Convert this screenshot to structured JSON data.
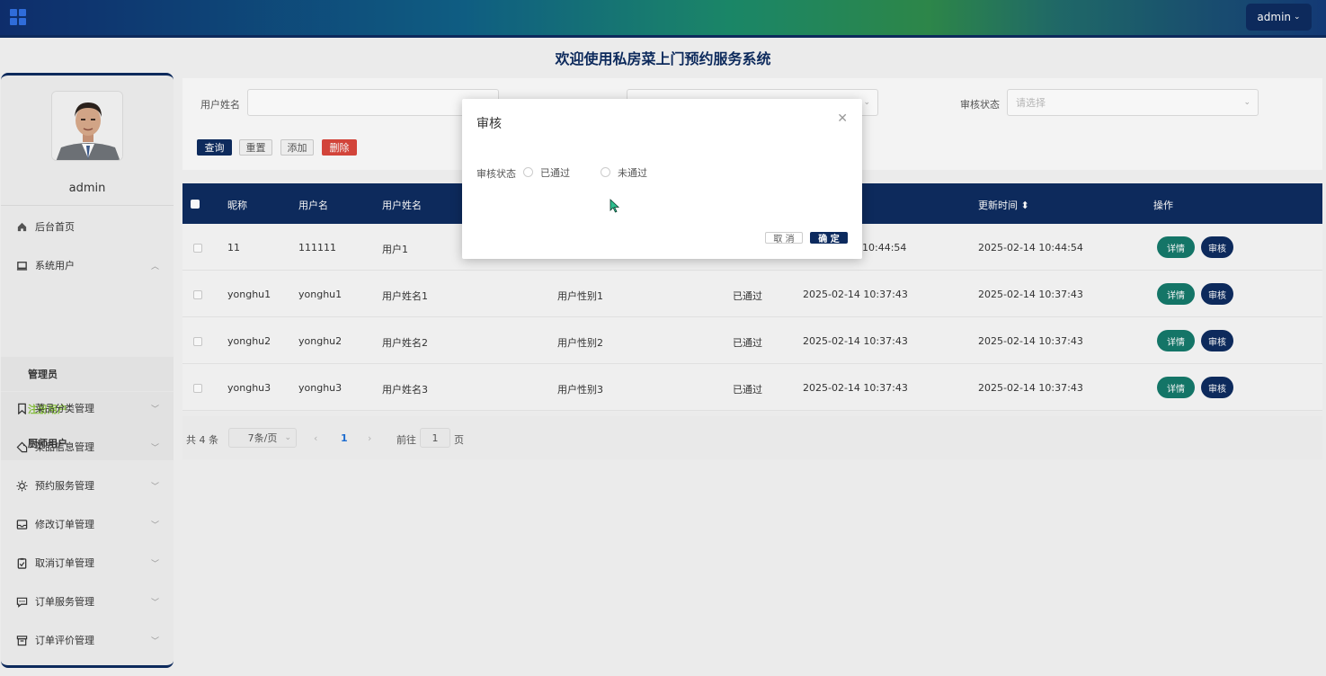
{
  "header": {
    "admin_label": "admin",
    "title": "欢迎使用私房菜上门预约服务系统"
  },
  "sidebar": {
    "username": "admin",
    "items": [
      {
        "label": "后台首页",
        "icon": "home-icon"
      },
      {
        "label": "系统用户",
        "icon": "laptop-icon",
        "expanded": true,
        "children": [
          {
            "label": "管理员"
          },
          {
            "label": "注册用户",
            "active": true
          },
          {
            "label": "厨师用户"
          }
        ]
      },
      {
        "label": "菜品分类管理",
        "icon": "bookmark-icon"
      },
      {
        "label": "菜品信息管理",
        "icon": "tag-icon"
      },
      {
        "label": "预约服务管理",
        "icon": "sun-icon"
      },
      {
        "label": "修改订单管理",
        "icon": "inbox-icon"
      },
      {
        "label": "取消订单管理",
        "icon": "clipboard-icon"
      },
      {
        "label": "订单服务管理",
        "icon": "message-icon"
      },
      {
        "label": "订单评价管理",
        "icon": "archive-icon"
      }
    ]
  },
  "search": {
    "name_label": "用户姓名",
    "status_label": "审核状态",
    "status_placeholder": "请选择",
    "btn_query": "查询",
    "btn_reset": "重置",
    "btn_add": "添加",
    "btn_delete": "删除"
  },
  "table": {
    "columns": [
      "昵称",
      "用户名",
      "用户姓名",
      "更新时间",
      "操作"
    ],
    "rows": [
      {
        "nickname": "11",
        "username": "111111",
        "realname": "用户1",
        "gender": "",
        "status": "",
        "created": "10:44:54",
        "updated": "2025-02-14 10:44:54"
      },
      {
        "nickname": "yonghu1",
        "username": "yonghu1",
        "realname": "用户姓名1",
        "gender": "用户性别1",
        "status": "已通过",
        "created": "2025-02-14 10:37:43",
        "updated": "2025-02-14 10:37:43"
      },
      {
        "nickname": "yonghu2",
        "username": "yonghu2",
        "realname": "用户姓名2",
        "gender": "用户性别2",
        "status": "已通过",
        "created": "2025-02-14 10:37:43",
        "updated": "2025-02-14 10:37:43"
      },
      {
        "nickname": "yonghu3",
        "username": "yonghu3",
        "realname": "用户姓名3",
        "gender": "用户性别3",
        "status": "已通过",
        "created": "2025-02-14 10:37:43",
        "updated": "2025-02-14 10:37:43"
      }
    ],
    "btn_detail": "详情",
    "btn_audit": "审核",
    "sort_icon": "sort-icon",
    "sort_glyph": "⬍"
  },
  "pager": {
    "total": "共 4 条",
    "page_size": "7条/页",
    "current": "1",
    "goto_label": "前往",
    "goto_value": "1",
    "page_suffix": "页"
  },
  "dialog": {
    "title": "审核",
    "field_label": "审核状态",
    "options": [
      "已通过",
      "未通过"
    ],
    "cancel": "取 消",
    "ok": "确 定"
  }
}
